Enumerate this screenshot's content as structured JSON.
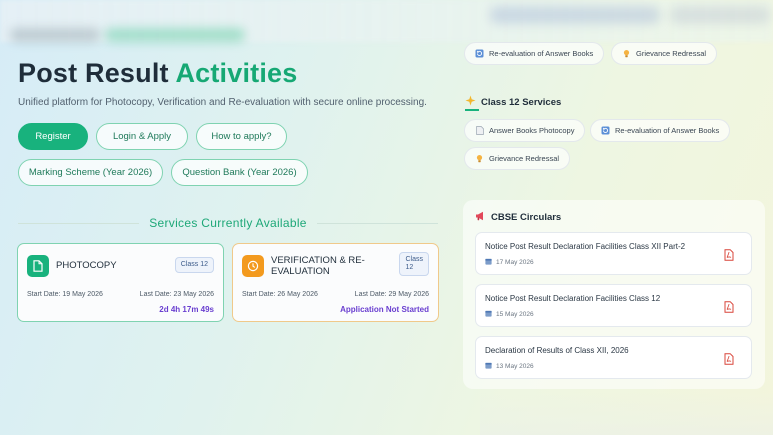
{
  "hero": {
    "title_main": "Post Result",
    "title_accent": "Activities",
    "subtitle": "Unified platform for Photocopy, Verification and Re-evaluation with secure online processing."
  },
  "actions": {
    "register": "Register",
    "login_apply": "Login & Apply",
    "how_to_apply": "How to apply?",
    "marking_scheme": "Marking Scheme (Year 2026)",
    "question_bank": "Question Bank (Year 2026)"
  },
  "services": {
    "heading": "Services Currently Available",
    "cards": [
      {
        "name": "PHOTOCOPY",
        "badge": "Class 12",
        "start_date": "Start Date: 19 May 2026",
        "last_date": "Last Date: 23 May 2026",
        "status": "2d 4h 17m 49s"
      },
      {
        "name": "VERIFICATION & RE-EVALUATION",
        "name_line1": "VERIFICATION & RE-",
        "name_line2": "EVALUATION",
        "badge_line1": "Class",
        "badge_line2": "12",
        "start_date": "Start Date: 26 May 2026",
        "last_date": "Last Date: 29 May 2026",
        "status": "Application Not Started"
      }
    ]
  },
  "top_chips": {
    "reevaluation": "Re-evaluation of Answer Books",
    "grievance": "Grievance Redressal"
  },
  "class12": {
    "title": "Class 12 Services",
    "chips": {
      "photocopy": "Answer Books Photocopy",
      "reevaluation": "Re-evaluation of Answer Books",
      "grievance": "Grievance Redressal"
    }
  },
  "circulars": {
    "title": "CBSE Circulars",
    "items": [
      {
        "title": "Notice Post Result Declaration Facilities Class XII Part-2",
        "date": "17 May 2026"
      },
      {
        "title": "Notice Post Result Declaration Facilities Class 12",
        "date": "15 May 2026"
      },
      {
        "title": "Declaration of Results of Class XII, 2026",
        "date": "13 May 2026"
      }
    ]
  },
  "colors": {
    "accent": "#18b27d",
    "accent_text": "#16a874",
    "orange": "#f39a1e",
    "countdown": "#6a3fd0",
    "pdf_red": "#d9453a"
  },
  "icons": [
    "document-icon",
    "clock-icon",
    "refresh-icon",
    "lightbulb-icon",
    "sparkle-icon",
    "megaphone-icon",
    "calendar-icon",
    "pdf-icon"
  ]
}
